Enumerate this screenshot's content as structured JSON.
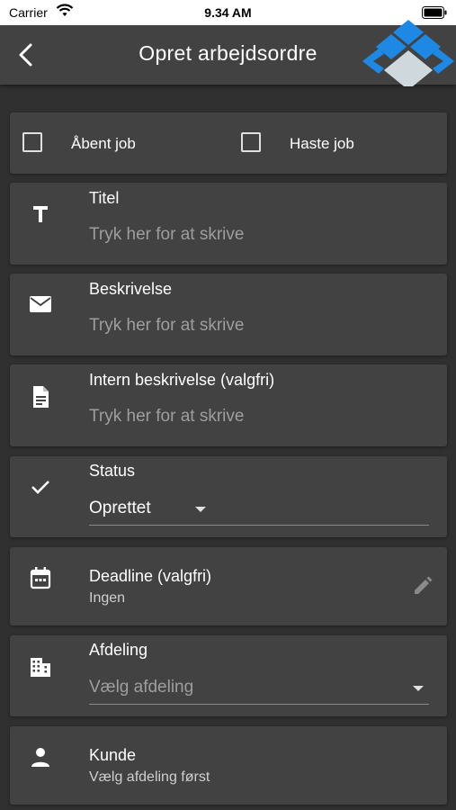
{
  "statusbar": {
    "carrier": "Carrier",
    "time": "9.34 AM"
  },
  "appbar": {
    "title": "Opret arbejdsordre"
  },
  "checkboxes": [
    {
      "label": "Åbent job",
      "checked": false
    },
    {
      "label": "Haste job",
      "checked": false
    }
  ],
  "fields": {
    "title": {
      "label": "Titel",
      "placeholder": "Tryk her for at skrive"
    },
    "description": {
      "label": "Beskrivelse",
      "placeholder": "Tryk her for at skrive"
    },
    "internal": {
      "label": "Intern beskrivelse (valgfri)",
      "placeholder": "Tryk her for at skrive"
    },
    "status": {
      "label": "Status",
      "value": "Oprettet"
    },
    "deadline": {
      "label": "Deadline (valgfri)",
      "value": "Ingen"
    },
    "department": {
      "label": "Afdeling",
      "placeholder": "Vælg afdeling"
    },
    "customer": {
      "label": "Kunde",
      "value": "Vælg afdeling først"
    }
  },
  "colors": {
    "background": "#303030",
    "card": "#424242",
    "appbar": "#424242",
    "logo_blue": "#1e88e5",
    "logo_grey": "#cfd8dc"
  }
}
